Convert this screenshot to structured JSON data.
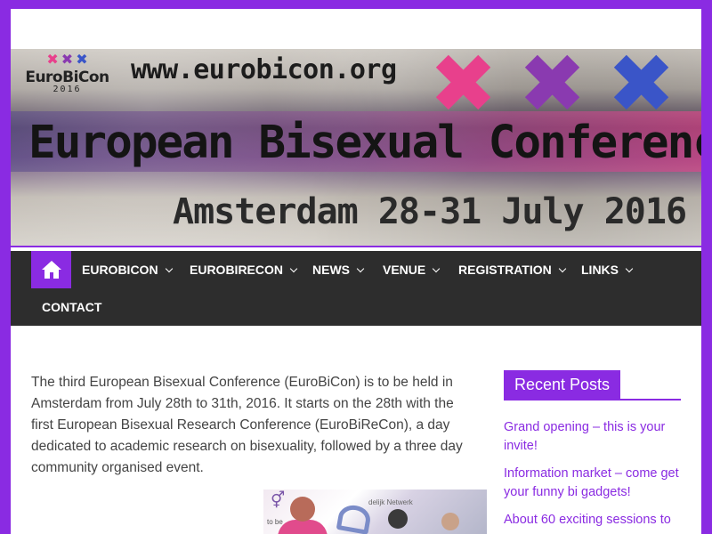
{
  "banner": {
    "logo_name": "EuroBiCon",
    "logo_year": "2016",
    "url": "www.eurobicon.org",
    "title": "European Bisexual Conference",
    "subtitle": "Amsterdam 28-31 July 2016",
    "x_colors": [
      "#e8408c",
      "#8a3ab0",
      "#3a55c8"
    ]
  },
  "nav": {
    "home_icon": "home-icon",
    "items": [
      {
        "label": "EUROBICON"
      },
      {
        "label": "EUROBIRECON"
      },
      {
        "label": "NEWS"
      },
      {
        "label": "VENUE"
      },
      {
        "label": "REGISTRATION"
      },
      {
        "label": "LINKS"
      },
      {
        "label": "CONTACT"
      }
    ]
  },
  "main": {
    "intro": "The third European Bisexual Conference (EuroBiCon) is to be held in Amsterdam from July 28th to 31th, 2016. It starts on the 28th with the first European Bisexual Research Conference (EuroBiReCon), a day dedicated to academic research on bisexuality, followed by a three day community organised event."
  },
  "sidebar": {
    "widget_title": "Recent Posts",
    "posts": [
      {
        "label": "Grand opening – this is your invite!"
      },
      {
        "label": "Information market – come get your funny bi gadgets!"
      },
      {
        "label": "About 60 exciting sessions to"
      }
    ]
  },
  "colors": {
    "accent": "#8a2be2",
    "nav_bg": "#2d2d2d",
    "text": "#444444"
  }
}
